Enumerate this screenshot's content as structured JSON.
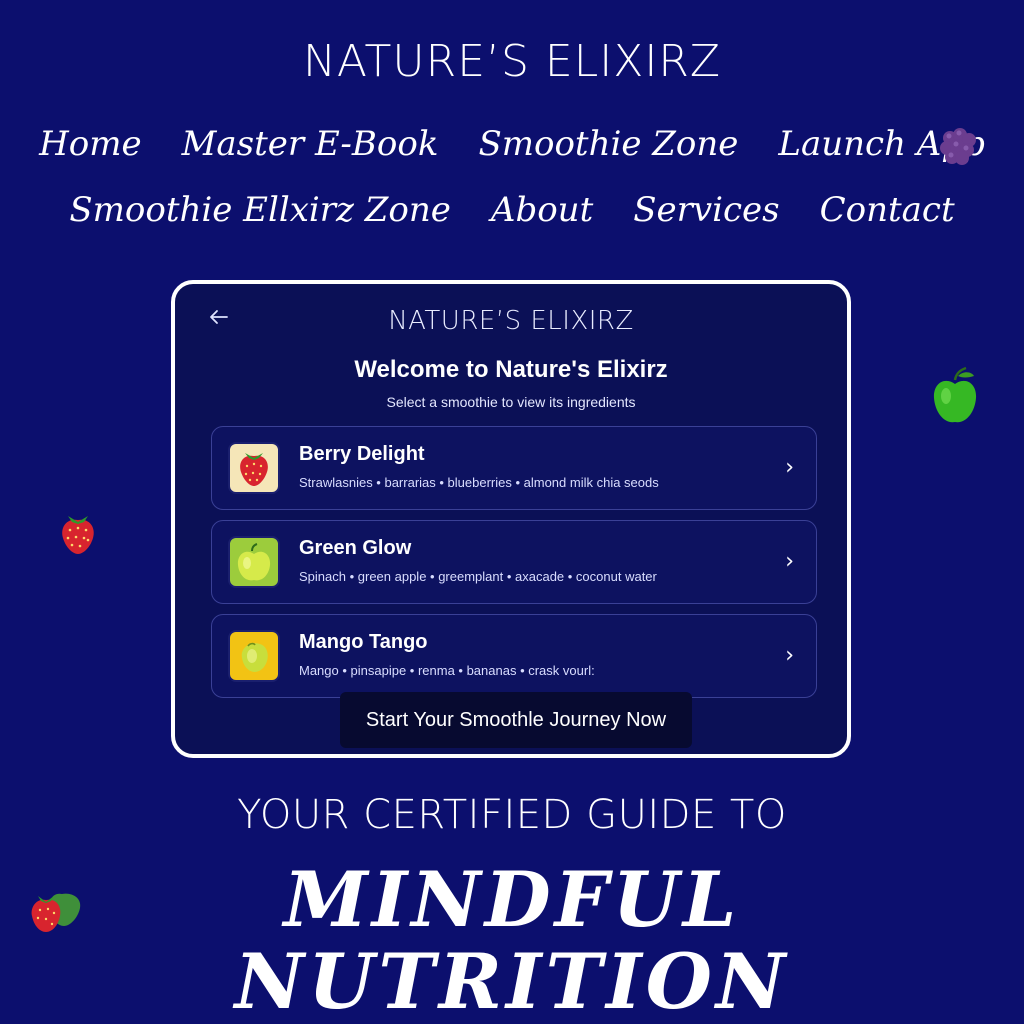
{
  "brand": "NATURE’S ELIXIRZ",
  "nav": {
    "row1": [
      "Home",
      "Master E-Book",
      "Smoothie Zone",
      "Launch App"
    ],
    "row2": [
      "Smoothie Ellxirz Zone",
      "About",
      "Services",
      "Contact"
    ]
  },
  "decorations": {
    "fruits": [
      "blackberry-icon",
      "green-apple-icon",
      "strawberry-icon",
      "strawberry-pair-icon"
    ]
  },
  "app_card": {
    "back_icon": "arrow-left-icon",
    "brand": "NATURE’S ELIXIRZ",
    "title": "Welcome to Nature's Elixirz",
    "subtitle": "Select a smoothie to view its ingredients",
    "smoothies": [
      {
        "name": "Berry Delight",
        "ingredients": "Strawlasnies • barrarias • blueberries • almond milk chia seods",
        "icon": "strawberry-icon",
        "thumb_color": "#f5e6b8"
      },
      {
        "name": "Green Glow",
        "ingredients": "Spinach • green apple • greemplant • axacade • coconut water",
        "icon": "green-apple-icon",
        "thumb_color": "#9ccc3c"
      },
      {
        "name": "Mango Tango",
        "ingredients": "Mango • pinsapipe • renma • bananas • crask vourl:",
        "icon": "mango-icon",
        "thumb_color": "#f2c314"
      }
    ],
    "chevron": "›",
    "cta": "Start Your Smoothle Journey Now"
  },
  "tagline": "YOUR CERTIFIED GUIDE TO",
  "headline": {
    "line1": "MINDFUL",
    "line2": "NUTRITION"
  },
  "colors": {
    "background": "#0c0f6e",
    "card_background": "#0b1056",
    "card_border": "#ffffff",
    "cta_background": "#070a30"
  }
}
